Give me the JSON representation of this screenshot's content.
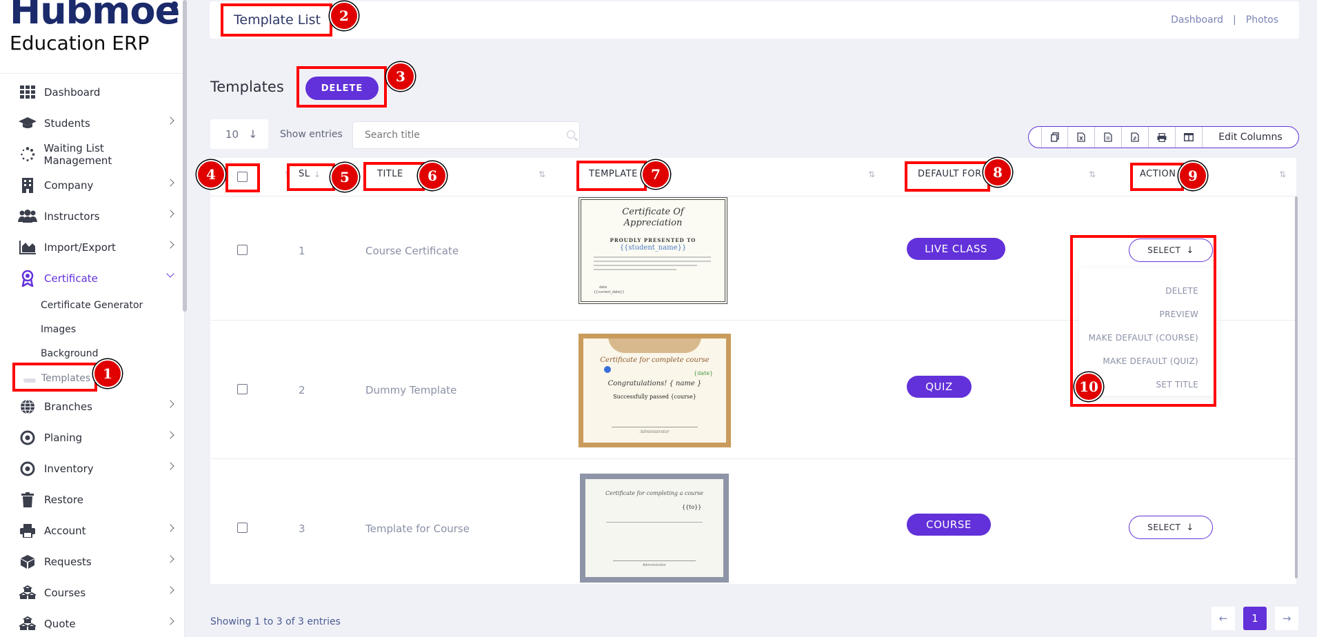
{
  "brand": {
    "name": "Hubmoe",
    "tagline": "Education ERP"
  },
  "sidebar": {
    "items": [
      {
        "label": "Dashboard",
        "icon": "grid-icon"
      },
      {
        "label": "Students",
        "icon": "graduation-cap-icon"
      },
      {
        "label": "Waiting List Management",
        "icon": "spinner-icon"
      },
      {
        "label": "Company",
        "icon": "building-icon"
      },
      {
        "label": "Instructors",
        "icon": "users-icon"
      },
      {
        "label": "Import/Export",
        "icon": "area-chart-icon"
      },
      {
        "label": "Certificate",
        "icon": "award-icon"
      },
      {
        "label": "Branches",
        "icon": "globe-icon"
      },
      {
        "label": "Planing",
        "icon": "target-icon"
      },
      {
        "label": "Inventory",
        "icon": "target-icon"
      },
      {
        "label": "Restore",
        "icon": "trash-icon"
      },
      {
        "label": "Account",
        "icon": "printer-icon"
      },
      {
        "label": "Requests",
        "icon": "cube-icon"
      },
      {
        "label": "Courses",
        "icon": "cubes-icon"
      },
      {
        "label": "Quote",
        "icon": "cubes-icon"
      }
    ],
    "certificate_sub": [
      "Certificate Generator",
      "Images",
      "Background",
      "Templates"
    ]
  },
  "header": {
    "title": "Template List",
    "breadcrumb": [
      "Dashboard",
      "Photos"
    ],
    "separator": "|"
  },
  "toolbar": {
    "section_title": "Templates",
    "delete_label": "DELETE",
    "entries_value": "10",
    "show_entries": "Show entries",
    "search_placeholder": "Search title",
    "edit_columns": "Edit Columns",
    "export_icons": [
      "copy-icon",
      "csv-icon",
      "excel-icon",
      "pdf-icon",
      "print-icon",
      "columns-icon"
    ]
  },
  "table": {
    "columns": [
      "SL",
      "TITLE",
      "TEMPLATE",
      "DEFAULT FOR",
      "ACTION"
    ],
    "rows": [
      {
        "sl": "1",
        "title": "Course Certificate",
        "default_for": "LIVE CLASS",
        "action": "SELECT"
      },
      {
        "sl": "2",
        "title": "Dummy Template",
        "default_for": "QUIZ",
        "action": "SELECT"
      },
      {
        "sl": "3",
        "title": "Template for Course",
        "default_for": "COURSE",
        "action": "SELECT"
      }
    ],
    "action_menu": [
      "DELETE",
      "PREVIEW",
      "MAKE DEFAULT (COURSE)",
      "MAKE DEFAULT (QUIZ)",
      "SET TITLE"
    ]
  },
  "certificates": {
    "c1": {
      "title": "Certificate Of",
      "title2": "Appreciation",
      "presented": "PROUDLY PRESENTED TO",
      "name": "{{student_name}}",
      "date_label": "date",
      "date_value": "{{current_date}}"
    },
    "c2": {
      "title": "Certificate for complete course",
      "date": "{date}",
      "congrats": "Congratulations! { name }",
      "passed": "Successfully passed {course}",
      "sign": "Administrator"
    },
    "c3": {
      "title": "Certificate for completing a course",
      "name": "{{to}}",
      "sign": "Administrator"
    }
  },
  "footer": {
    "showing": "Showing 1 to 3 of 3 entries",
    "current_page": "1"
  },
  "annotations": [
    "1",
    "2",
    "3",
    "4",
    "5",
    "6",
    "7",
    "8",
    "9",
    "10"
  ],
  "colors": {
    "accent": "#6231d9",
    "annotation": "#ff0000",
    "brand": "#1b2a6b"
  }
}
